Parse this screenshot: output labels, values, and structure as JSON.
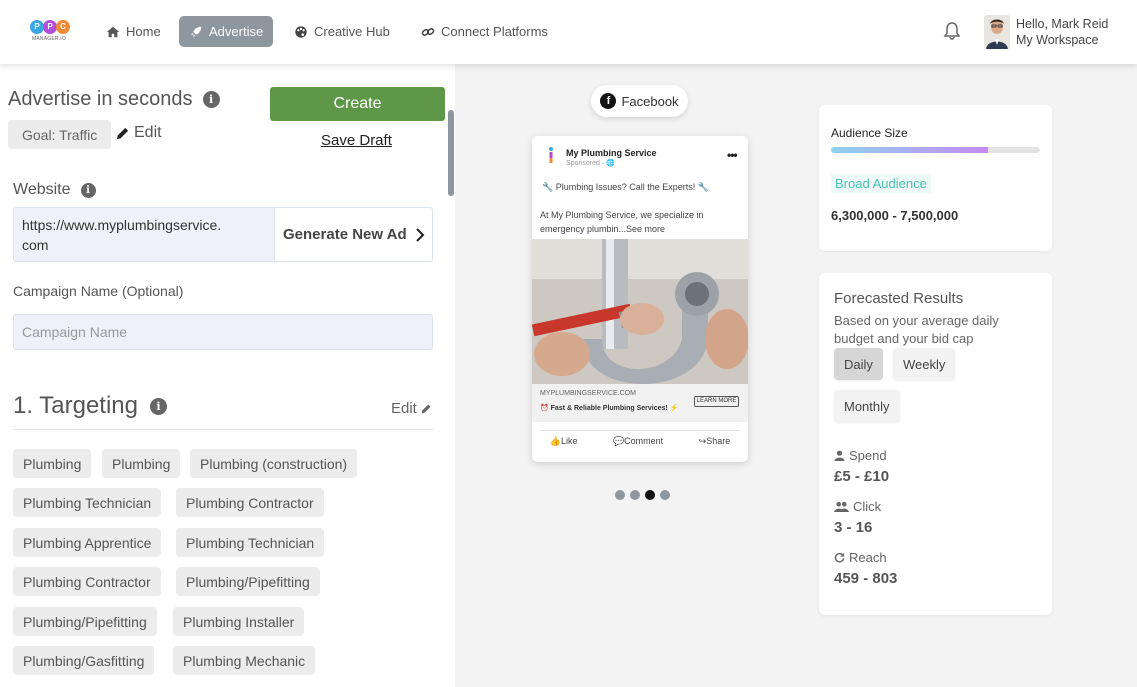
{
  "nav": {
    "logo_letters": [
      "P",
      "P",
      "C"
    ],
    "logo_sub": "MANAGER.IO",
    "items": [
      {
        "label": "Home",
        "icon": "home-icon"
      },
      {
        "label": "Advertise",
        "icon": "rocket-icon",
        "active": true
      },
      {
        "label": "Creative Hub",
        "icon": "palette-icon"
      },
      {
        "label": "Connect Platforms",
        "icon": "link-icon"
      }
    ],
    "user_greeting": "Hello, Mark Reid",
    "workspace": "My Workspace"
  },
  "left": {
    "title": "Advertise in seconds",
    "create_label": "Create",
    "goal_label": "Goal: Traffic",
    "edit_label": "Edit",
    "save_draft_label": "Save Draft",
    "website_label": "Website",
    "website_value": "https://www.myplumbingservice.com",
    "website_value_line1": "https://www.myplumbingservice.",
    "website_value_line2": "com",
    "generate_label": "Generate New Ad",
    "campaign_label": "Campaign Name (Optional)",
    "campaign_placeholder": "Campaign Name",
    "targeting_title": "1.  Targeting",
    "targeting_edit": "Edit",
    "tags": [
      "Plumbing",
      "Plumbing",
      "Plumbing (construction)",
      "Plumbing Technician",
      "Plumbing Contractor",
      "Plumbing Apprentice",
      "Plumbing Technician",
      "Plumbing Contractor",
      "Plumbing/Pipefitting",
      "Plumbing/Pipefitting",
      "Plumbing Installer",
      "Plumbing/Gasfitting",
      "Plumbing Mechanic"
    ]
  },
  "preview": {
    "platform": "Facebook",
    "page_name": "My Plumbing Service",
    "sponsored": "Sponsored · 🌐",
    "hook": "🔧 Plumbing Issues? Call the Experts! 🔧",
    "body": "At My Plumbing Service, we specialize in emergency plumbin...See more",
    "domain": "MYPLUMBINGSERVICE.COM",
    "tagline": "⏰ Fast & Reliable Plumbing Services! ⚡",
    "cta": "LEARN MORE",
    "like": "Like",
    "comment": "Comment",
    "share": "Share",
    "slides": 4,
    "active_slide": 3
  },
  "audience": {
    "title": "Audience Size",
    "fill_fraction": 0.75,
    "label": "Broad Audience",
    "range": "6,300,000 - 7,500,000"
  },
  "forecast": {
    "title": "Forecasted Results",
    "desc": "Based on your average daily budget and your bid cap",
    "periods": [
      "Daily",
      "Weekly",
      "Monthly"
    ],
    "active_period": "Daily",
    "spend_label": "Spend",
    "spend_value": "£5 - £10",
    "click_label": "Click",
    "click_value": "3 - 16",
    "reach_label": "Reach",
    "reach_value": "459 - 803"
  },
  "colors": {
    "create_green": "#5f9749",
    "nav_active": "#8e96a0",
    "broad_teal": "#4cc0b3"
  }
}
